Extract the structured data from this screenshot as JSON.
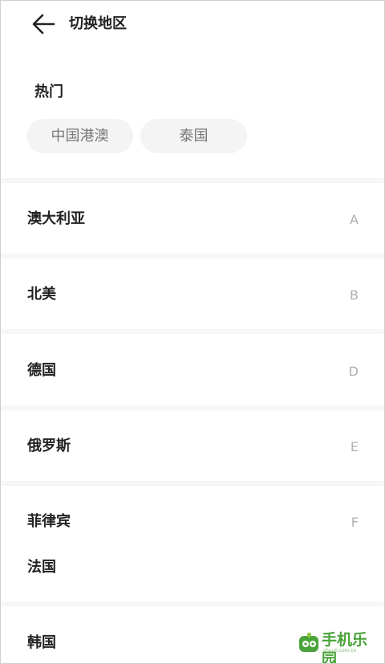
{
  "header": {
    "title": "切换地区",
    "back_icon": "arrow-left-icon"
  },
  "hot": {
    "title": "热门",
    "chips": [
      "中国港澳",
      "泰国"
    ]
  },
  "regions": [
    {
      "label": "澳大利亚",
      "letter": "A"
    },
    {
      "label": "北美",
      "letter": "B"
    },
    {
      "label": "德国",
      "letter": "D"
    },
    {
      "label": "俄罗斯",
      "letter": "E"
    },
    {
      "label": "菲律宾",
      "letter": "F"
    },
    {
      "label": "法国",
      "letter": ""
    },
    {
      "label": "韩国",
      "letter": ""
    }
  ],
  "watermark": {
    "text": "手机乐园",
    "sub": "shouji.com.cn",
    "color": "#4aa33a"
  }
}
